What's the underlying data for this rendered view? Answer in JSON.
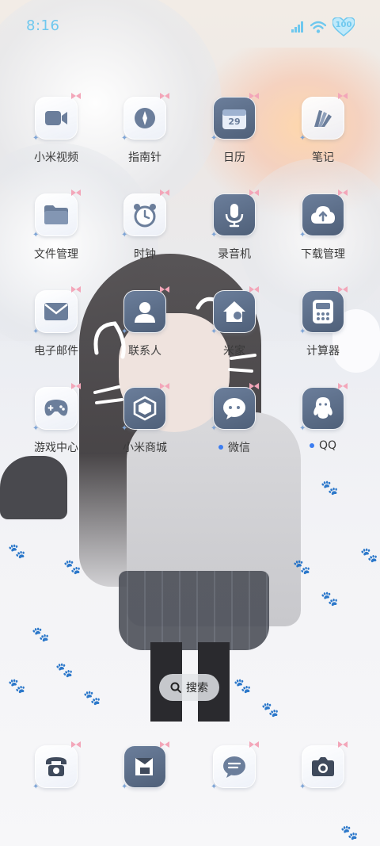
{
  "status_bar": {
    "time": "8:16",
    "battery": "100",
    "accent_color": "#6fc8ee",
    "icons": [
      "signal-icon",
      "wifi-icon",
      "battery-heart-icon"
    ]
  },
  "apps": [
    {
      "label": "小米视频",
      "icon": "video-icon",
      "dot": false
    },
    {
      "label": "指南针",
      "icon": "compass-icon",
      "dot": false
    },
    {
      "label": "日历",
      "icon": "calendar-icon",
      "date": "29",
      "dot": false
    },
    {
      "label": "笔记",
      "icon": "notes-icon",
      "dot": false
    },
    {
      "label": "文件管理",
      "icon": "folder-icon",
      "dot": false
    },
    {
      "label": "时钟",
      "icon": "clock-icon",
      "dot": false
    },
    {
      "label": "录音机",
      "icon": "microphone-icon",
      "dot": false
    },
    {
      "label": "下载管理",
      "icon": "download-icon",
      "dot": false
    },
    {
      "label": "电子邮件",
      "icon": "mail-icon",
      "dot": false
    },
    {
      "label": "联系人",
      "icon": "contacts-icon",
      "dot": false
    },
    {
      "label": "米家",
      "icon": "smart-home-icon",
      "dot": false
    },
    {
      "label": "计算器",
      "icon": "calculator-icon",
      "dot": false
    },
    {
      "label": "游戏中心",
      "icon": "gamepad-icon",
      "dot": false
    },
    {
      "label": "小米商城",
      "icon": "mi-store-icon",
      "dot": false
    },
    {
      "label": "微信",
      "icon": "wechat-icon",
      "dot": true
    },
    {
      "label": "QQ",
      "icon": "qq-icon",
      "dot": true
    }
  ],
  "search": {
    "label": "搜索",
    "icon": "search-icon"
  },
  "dock": [
    {
      "icon": "phone-icon"
    },
    {
      "icon": "browser-icon"
    },
    {
      "icon": "messages-icon"
    },
    {
      "icon": "camera-icon"
    }
  ],
  "colors": {
    "notification_dot": "#3c7df1",
    "icon_glyph": "#6b7e9b"
  }
}
